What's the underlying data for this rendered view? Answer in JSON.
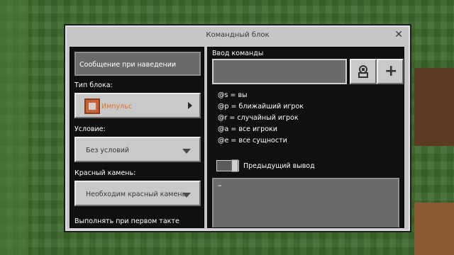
{
  "window": {
    "title": "Командный блок",
    "close_symbol": "✕"
  },
  "left": {
    "hover_note": "Сообщение при наведении",
    "block_type": {
      "label": "Тип блока:",
      "value": "Импульс",
      "value_color": "#e0722b"
    },
    "condition": {
      "label": "Условие:",
      "value": "Без условий"
    },
    "redstone": {
      "label": "Красный камень:",
      "value": "Необходим красный камень"
    },
    "first_tick": "Выполнять при первом такте"
  },
  "right": {
    "input_label": "Ввод команды",
    "buttons": [
      {
        "icon": "paste-command-icon"
      },
      {
        "label": "+"
      }
    ],
    "selectors": [
      "@s = вы",
      "@p = ближайший игрок",
      "@r = случайный игрок",
      "@a = все игроки",
      "@e = все сущности"
    ],
    "previous_output_label": "Предыдущий вывод",
    "output_text": "–"
  },
  "colors": {
    "background": "#3f6a2e",
    "dialog": "#c6c6c6",
    "panel": "#101010"
  }
}
